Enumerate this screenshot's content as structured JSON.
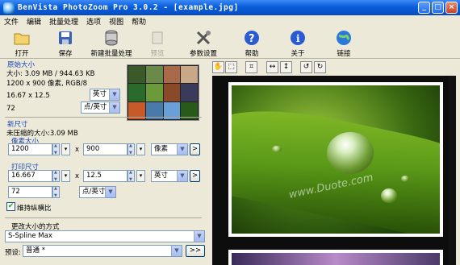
{
  "window": {
    "title": "BenVista PhotoZoom Pro 3.0.2 - [example.jpg]",
    "buttons": [
      "_",
      "□",
      "×"
    ]
  },
  "menu": [
    "文件",
    "编辑",
    "批量处理",
    "选项",
    "视图",
    "帮助"
  ],
  "toolbar": {
    "open": "打开",
    "save": "保存",
    "new_batch": "新建批量处理",
    "preview": "预览",
    "settings": "参数设置",
    "help": "帮助",
    "about": "关于",
    "link": "链接"
  },
  "original": {
    "heading": "原始大小",
    "size_line": "大小: 3.09 MB / 944.63 KB",
    "pixels_line": "1200 x 900 像素, RGB/8",
    "dims": "16.67 x 12.5",
    "unit": "英寸",
    "res": "72",
    "res_unit": "点/英寸"
  },
  "new_size": {
    "heading": "新尺寸",
    "uncompressed": "未压缩的大小:3.09 MB",
    "pixel_heading": "像素大小",
    "width": "1200",
    "height": "900",
    "x": "x",
    "pixel_unit": "像素",
    "print_heading": "打印尺寸",
    "print_width": "16.667",
    "print_height": "12.5",
    "print_unit": "英寸",
    "resolution": "72",
    "res_unit": "点/英寸",
    "keep_ratio": "维持纵横比",
    "go": ">"
  },
  "method": {
    "heading": "更改大小的方式",
    "value": "S-Spline Max",
    "preset_label": "预设:",
    "preset_value": "普通 *",
    "more": ">>"
  },
  "view_tools": [
    "hand-icon",
    "select-icon",
    "crop-icon",
    "fit-width-icon",
    "fit-height-icon",
    "rotate-left-icon",
    "rotate-right-icon"
  ],
  "watermark": "www.Duote.com"
}
